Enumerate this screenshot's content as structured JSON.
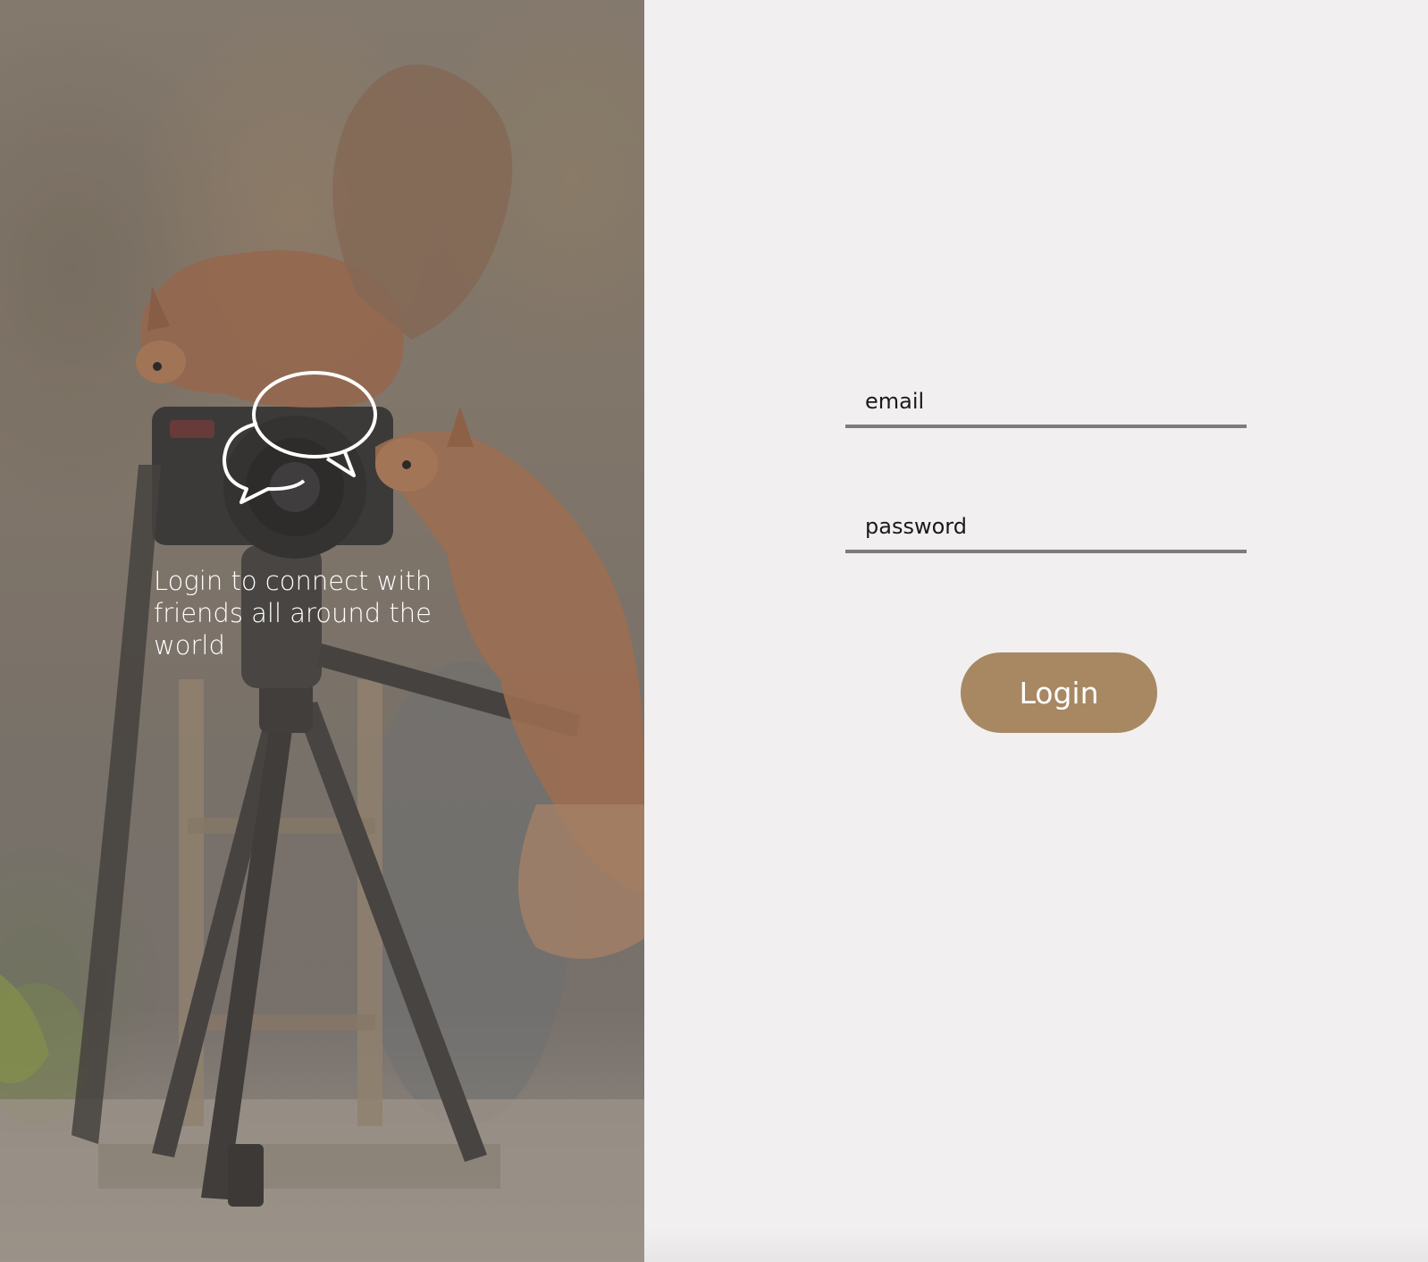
{
  "hero": {
    "tagline": "Login to connect with friends all around the world",
    "icon": "chat-bubbles-icon",
    "photo": "squirrels-with-camera-photo"
  },
  "form": {
    "email_placeholder": "email",
    "password_placeholder": "password",
    "login_label": "Login"
  },
  "colors": {
    "accent": "#a78862",
    "background": "#f1eff0",
    "underline": "#7d7b7c",
    "hero_text": "#ffffff"
  }
}
